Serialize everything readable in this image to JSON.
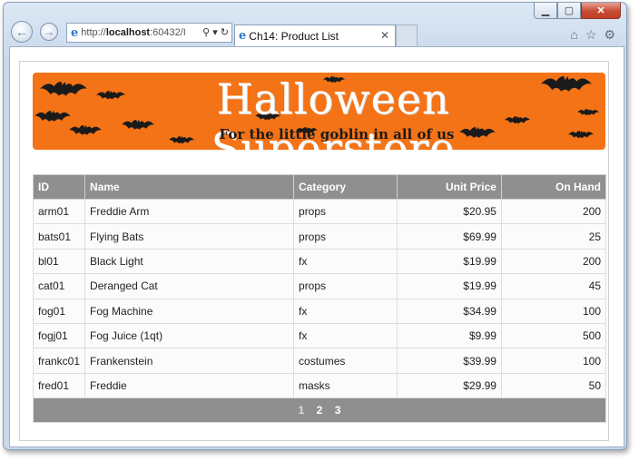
{
  "browser": {
    "address": {
      "scheme": "http://",
      "host": "localhost",
      "rest": ":60432/I"
    },
    "tab_title": "Ch14: Product List",
    "tab_close": "✕",
    "caption": {
      "minimize": "▁",
      "maximize": "▢",
      "close": "✕"
    },
    "icons": [
      "home-icon",
      "favorites-star-icon",
      "settings-gear-icon"
    ]
  },
  "banner": {
    "title": "Halloween Superstore",
    "tagline": "For the little goblin in all of us",
    "color": "#f47317"
  },
  "table": {
    "headers": {
      "id": "ID",
      "name": "Name",
      "category": "Category",
      "price": "Unit Price",
      "onhand": "On Hand"
    },
    "rows": [
      {
        "id": "arm01",
        "name": "Freddie Arm",
        "category": "props",
        "price": "$20.95",
        "onhand": "200"
      },
      {
        "id": "bats01",
        "name": "Flying Bats",
        "category": "props",
        "price": "$69.99",
        "onhand": "25"
      },
      {
        "id": "bl01",
        "name": "Black Light",
        "category": "fx",
        "price": "$19.99",
        "onhand": "200"
      },
      {
        "id": "cat01",
        "name": "Deranged Cat",
        "category": "props",
        "price": "$19.99",
        "onhand": "45"
      },
      {
        "id": "fog01",
        "name": "Fog Machine",
        "category": "fx",
        "price": "$34.99",
        "onhand": "100"
      },
      {
        "id": "fogj01",
        "name": "Fog Juice (1qt)",
        "category": "fx",
        "price": "$9.99",
        "onhand": "500"
      },
      {
        "id": "frankc01",
        "name": "Frankenstein",
        "category": "costumes",
        "price": "$39.99",
        "onhand": "100"
      },
      {
        "id": "fred01",
        "name": "Freddie",
        "category": "masks",
        "price": "$29.99",
        "onhand": "50"
      }
    ],
    "pager": {
      "pages": [
        "1",
        "2",
        "3"
      ],
      "current": "1"
    },
    "header_color": "#8f8f8f"
  }
}
